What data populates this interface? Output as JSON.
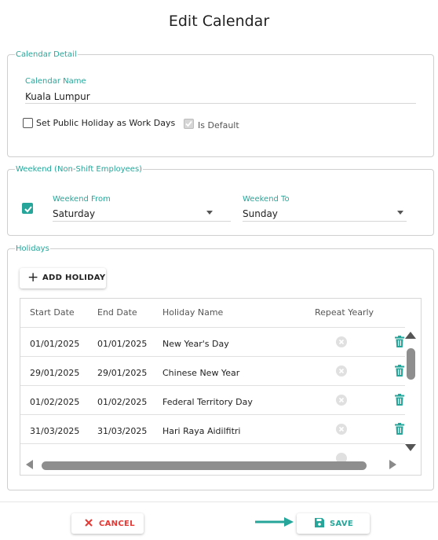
{
  "title": "Edit Calendar",
  "calendar_detail": {
    "legend": "Calendar Detail",
    "name_label": "Calendar Name",
    "name_value": "Kuala Lumpur",
    "public_holiday_label": "Set Public Holiday as Work Days",
    "public_holiday_checked": false,
    "is_default_label": "Is Default",
    "is_default_checked": true
  },
  "weekend": {
    "legend": "Weekend (Non-Shift Employees)",
    "enabled": true,
    "from_label": "Weekend From",
    "from_value": "Saturday",
    "to_label": "Weekend To",
    "to_value": "Sunday"
  },
  "holidays": {
    "legend": "Holidays",
    "add_button": "ADD HOLIDAY",
    "columns": [
      "Start Date",
      "End Date",
      "Holiday Name",
      "Repeat Yearly"
    ],
    "rows": [
      {
        "start": "01/01/2025",
        "end": "01/01/2025",
        "name": "New Year's Day",
        "repeat": false
      },
      {
        "start": "29/01/2025",
        "end": "29/01/2025",
        "name": "Chinese New Year",
        "repeat": false
      },
      {
        "start": "01/02/2025",
        "end": "01/02/2025",
        "name": "Federal Territory Day",
        "repeat": false
      },
      {
        "start": "31/03/2025",
        "end": "31/03/2025",
        "name": "Hari Raya Aidilfitri",
        "repeat": false
      }
    ]
  },
  "footer": {
    "cancel": "CANCEL",
    "save": "SAVE"
  },
  "colors": {
    "accent": "#26a69a",
    "danger": "#e53935"
  },
  "icons": {
    "add": "plus-icon",
    "checkbox": "check-icon",
    "dropdown": "caret-down-icon",
    "repeat": "close-circle-icon",
    "delete": "trash-icon",
    "cancel": "x-icon",
    "save": "floppy-disk-icon",
    "pointer": "arrow-right-icon"
  }
}
